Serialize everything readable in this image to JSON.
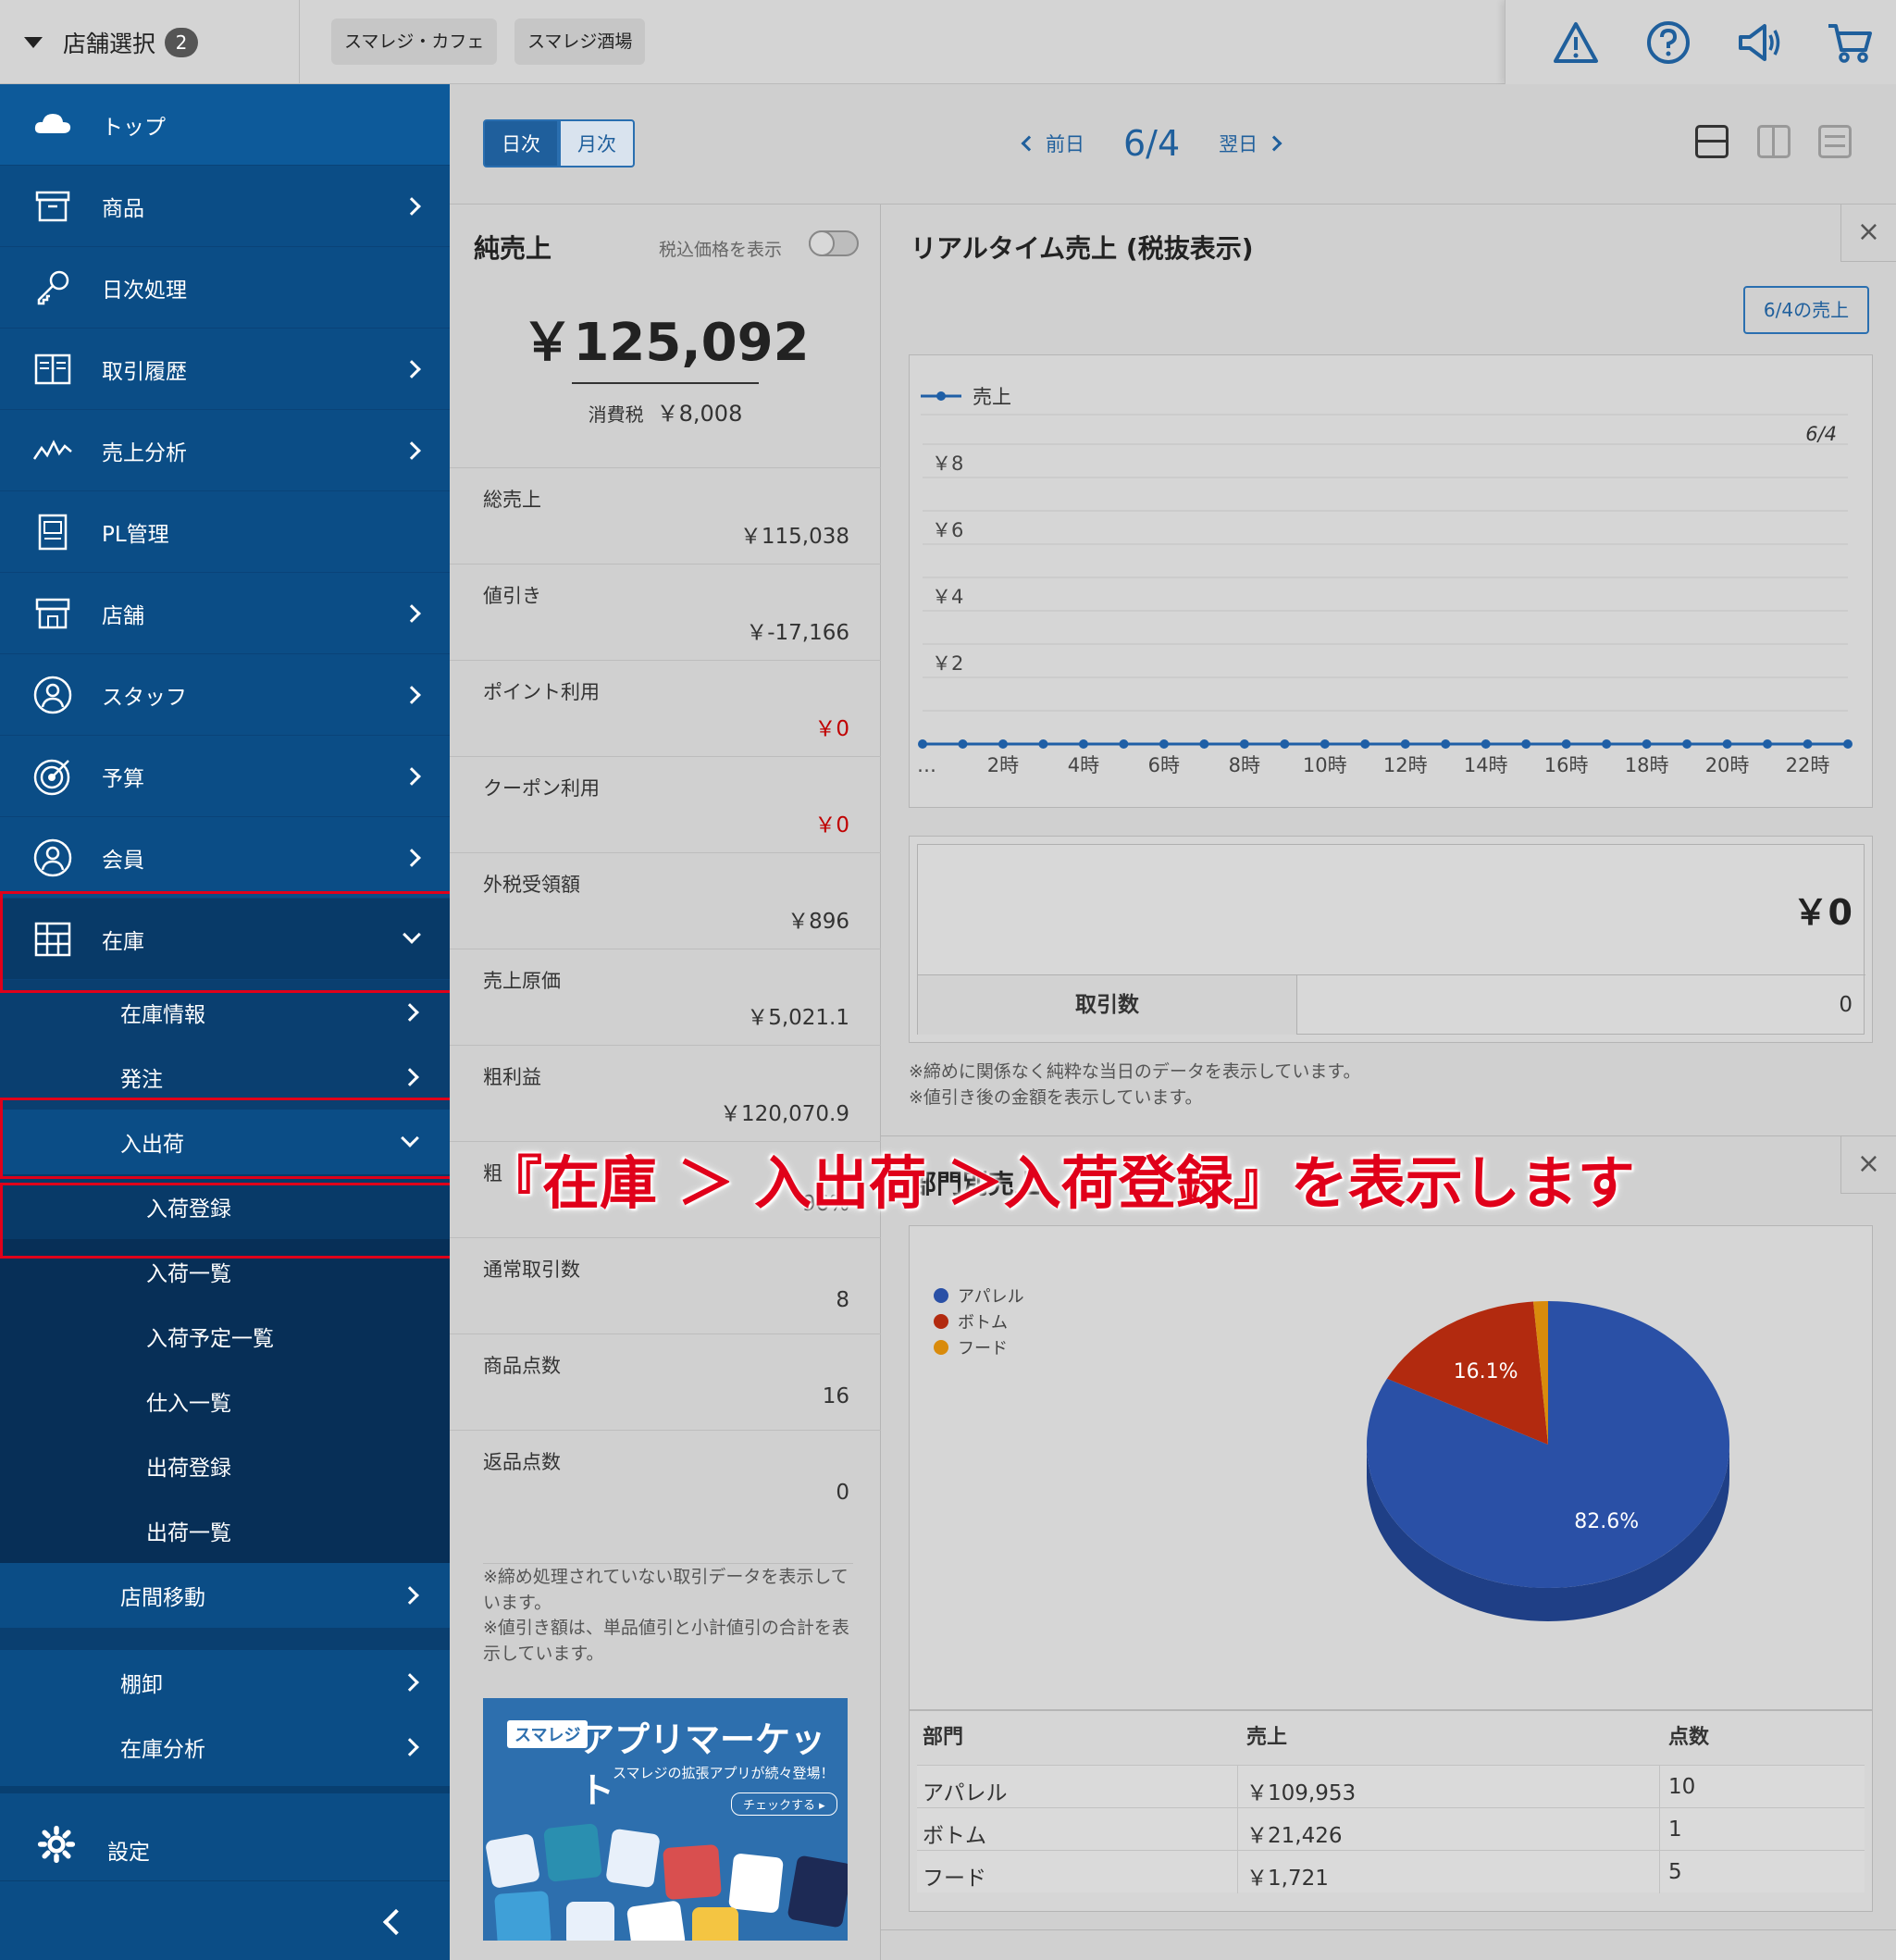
{
  "topbar": {
    "store_select_label": "店舗選択",
    "store_count": "2",
    "stores": [
      "スマレジ・カフェ",
      "スマレジ酒場"
    ],
    "icons": [
      "warning-icon",
      "help-icon",
      "announcement-icon",
      "cart-icon"
    ]
  },
  "sidebar": {
    "items": [
      {
        "label": "トップ",
        "icon": "cloud-icon"
      },
      {
        "label": "商品",
        "icon": "box-icon"
      },
      {
        "label": "日次処理",
        "icon": "key-icon"
      },
      {
        "label": "取引履歴",
        "icon": "book-icon"
      },
      {
        "label": "売上分析",
        "icon": "trend-icon"
      },
      {
        "label": "PL管理",
        "icon": "report-icon"
      },
      {
        "label": "店舗",
        "icon": "store-icon"
      },
      {
        "label": "スタッフ",
        "icon": "staff-icon"
      },
      {
        "label": "予算",
        "icon": "target-icon"
      },
      {
        "label": "会員",
        "icon": "member-icon"
      },
      {
        "label": "在庫",
        "icon": "inventory-icon"
      }
    ],
    "inventory_sub": [
      {
        "label": "在庫情報"
      },
      {
        "label": "発注"
      },
      {
        "label": "入出荷"
      }
    ],
    "shipping_sub": [
      {
        "label": "入荷登録"
      },
      {
        "label": "入荷一覧"
      },
      {
        "label": "入荷予定一覧"
      },
      {
        "label": "仕入一覧"
      },
      {
        "label": "出荷登録"
      },
      {
        "label": "出荷一覧"
      }
    ],
    "inventory_sub_after": [
      {
        "label": "店間移動"
      },
      {
        "label": "棚卸"
      },
      {
        "label": "在庫分析"
      }
    ],
    "settings_label": "設定"
  },
  "header": {
    "seg_day": "日次",
    "seg_month": "月次",
    "prev_label": "前日",
    "current_date": "6/4",
    "next_label": "翌日"
  },
  "summary": {
    "title": "純売上",
    "tax_toggle_label": "税込価格を表示",
    "net_amount": "￥125,092",
    "tax_label": "消費税",
    "tax_value": "￥8,008",
    "rows": [
      {
        "label": "総売上",
        "value": "￥115,038"
      },
      {
        "label": "値引き",
        "value": "￥-17,166"
      },
      {
        "label": "ポイント利用",
        "value": "￥0"
      },
      {
        "label": "クーポン利用",
        "value": "￥0"
      },
      {
        "label": "外税受領額",
        "value": "￥896"
      },
      {
        "label": "売上原価",
        "value": "￥5,021.1"
      },
      {
        "label": "粗利益",
        "value": "￥120,070.9"
      },
      {
        "label": "粗",
        "value": "96%"
      },
      {
        "label": "通常取引数",
        "value": "8"
      },
      {
        "label": "商品点数",
        "value": "16"
      },
      {
        "label": "返品点数",
        "value": "0"
      }
    ],
    "note1": "※締め処理されていない取引データを表示しています。",
    "note2": "※値引き額は、単品値引と小計値引の合計を表示しています。",
    "banner_logo": "スマレジ",
    "banner_title": "アプリマーケット",
    "banner_sub": "スマレジの拡張アプリが続々登場！",
    "banner_button": "チェックする ▸"
  },
  "realtime": {
    "title": "リアルタイム売上 (税抜表示)",
    "button": "6/4の売上",
    "total": "￥0",
    "tx_label": "取引数",
    "tx_value": "0",
    "note1": "※締めに関係なく純粋な当日のデータを表示しています。",
    "note2": "※値引き後の金額を表示しています。"
  },
  "chart_data": [
    {
      "type": "line",
      "title": "",
      "series": [
        {
          "name": "売上",
          "values": [
            0,
            0,
            0,
            0,
            0,
            0,
            0,
            0,
            0,
            0,
            0,
            0,
            0,
            0,
            0,
            0,
            0,
            0,
            0,
            0,
            0,
            0,
            0,
            0
          ]
        }
      ],
      "x": [
        "0時",
        "1時",
        "2時",
        "3時",
        "4時",
        "5時",
        "6時",
        "7時",
        "8時",
        "9時",
        "10時",
        "11時",
        "12時",
        "13時",
        "14時",
        "15時",
        "16時",
        "17時",
        "18時",
        "19時",
        "20時",
        "21時",
        "22時",
        "23時"
      ],
      "x_tick_labels": [
        "…",
        "2時",
        "4時",
        "6時",
        "8時",
        "10時",
        "12時",
        "14時",
        "16時",
        "18時",
        "20時",
        "22時"
      ],
      "y_tick_labels": [
        "￥2",
        "￥4",
        "￥6",
        "￥8"
      ],
      "legend_date": "6/4",
      "ylim": [
        0,
        10
      ],
      "legend": "top-left",
      "grid": true
    },
    {
      "type": "pie",
      "title": "部門別売上",
      "categories": [
        "アパレル",
        "ボトム",
        "フード"
      ],
      "values": [
        82.6,
        16.1,
        1.3
      ],
      "data_labels": [
        "82.6%",
        "16.1%"
      ],
      "colors": [
        "#2a50a6",
        "#b22a0f",
        "#d98b0c"
      ],
      "legend": "top-left"
    }
  ],
  "dept": {
    "title_partial": "部門別売上",
    "headers": [
      "部門",
      "売上",
      "点数"
    ],
    "rows": [
      [
        "アパレル",
        "￥109,953",
        "10"
      ],
      [
        "ボトム",
        "￥21,426",
        "1"
      ],
      [
        "フード",
        "￥1,721",
        "5"
      ]
    ]
  },
  "annotation": "『在庫 ＞ 入出荷 ＞入荷登録』を表示します",
  "colors": {
    "sidebar": "#0b4d86",
    "accent": "#1f5f9c",
    "annotation_red": "#e0001a"
  }
}
